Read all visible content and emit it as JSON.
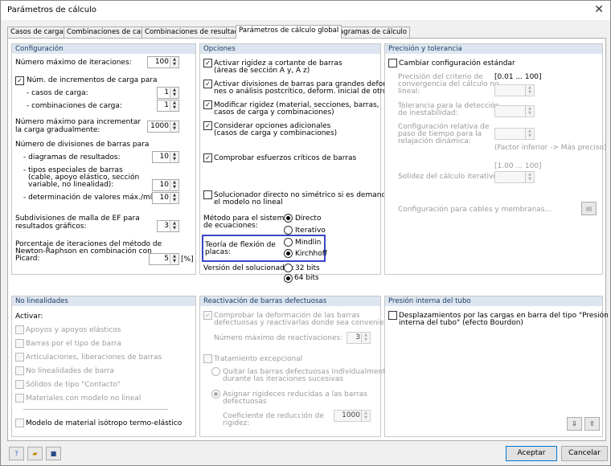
{
  "window": {
    "title": "Parámetros de cálculo",
    "close": "✕"
  },
  "tabs": [
    "Casos de carga",
    "Combinaciones de carga",
    "Combinaciones de resultados",
    "Parámetros de cálculo global",
    "Diagramas de cálculo"
  ],
  "config": {
    "header": "Configuración",
    "max_iter_label": "Número máximo de iteraciones:",
    "max_iter": "100",
    "incr_label": "Núm. de incrementos de carga para",
    "incr_cases_label": "- casos de carga:",
    "incr_cases": "1",
    "incr_combos_label": "- combinaciones de carga:",
    "incr_combos": "1",
    "max_grad_label1": "Número máximo para incrementar",
    "max_grad_label2": "la carga gradualmente:",
    "max_grad": "1000",
    "div_label": "Número de divisiones de barras para",
    "div_diag_label": "- diagramas de resultados:",
    "div_diag": "10",
    "div_special_label1": "- tipos especiales de barras",
    "div_special_label2": "(cable, apoyo elástico, sección",
    "div_special_label3": "variable, no linealidad):",
    "div_special": "10",
    "div_minmax_label": "- determinación de valores máx./mín.:",
    "div_minmax": "10",
    "mesh_label1": "Subdivisiones de malla de EF para",
    "mesh_label2": "resultados gráficos:",
    "mesh": "3",
    "nr_label1": "Porcentaje de iteraciones del método de",
    "nr_label2": "Newton-Raphson en combinación con",
    "nr_label3": "Picard:",
    "nr": "5",
    "nr_unit": "[%]"
  },
  "options": {
    "header": "Opciones",
    "shear1": "Activar rigidez a cortante de barras",
    "shear2": "(áreas de sección A y, A z)",
    "div1": "Activar divisiones de barras para grandes deformacio-",
    "div2": "nes o análisis postcrítico, deform. inicial de otro CC/CO",
    "modify1": "Modificar rigidez (material, secciones, barras,",
    "modify2": "casos de carga y combinaciones)",
    "additional1": "Considerar opciones adicionales",
    "additional2": "(casos de carga y combinaciones)",
    "critical": "Comprobar esfuerzos críticos de barras",
    "direct1": "Solucionador directo no simétrico si es demandado por",
    "direct2": "el modelo no lineal",
    "method_label1": "Método para el sistema",
    "method_label2": "de ecuaciones:",
    "method_direct": "Directo",
    "method_iter": "Iterativo",
    "plate_label1": "Teoría de flexión de",
    "plate_label2": "placas:",
    "mindlin": "Mindlin",
    "kirchhoff": "Kirchhoff",
    "solver_label": "Versión del solucionador:",
    "bits32": "32 bits",
    "bits64": "64 bits"
  },
  "precision": {
    "header": "Precisión y tolerancia",
    "change": "Cambiar configuración estándar",
    "conv1": "Precisión del criterio de",
    "conv2": "convergencia del cálculo no",
    "conv3": "lineal:",
    "conv_range": "[0.01 ... 100]",
    "tol1": "Tolerancia para la detección",
    "tol2": "de inestabilidad:",
    "step1": "Configuración relativa de",
    "step2": "paso de tiempo para la",
    "step3": "relajación dinámica:",
    "step_hint": "(Factor inferior -> Más preciso)",
    "solid_label": "Solidez del cálculo iterativo:",
    "solid_range": "[1.00 ... 100]",
    "cables": "Configuración para cables y membranas..."
  },
  "nonlin": {
    "header": "No linealidades",
    "activate": "Activar:",
    "items": [
      "Apoyos y apoyos elásticos",
      "Barras por el tipo de barra",
      "Articulaciones, liberaciones de barras",
      "No linealidades de barra",
      "Sólidos de tipo \"Contacto\"",
      "Materiales con modelo no lineal"
    ],
    "thermo": "Modelo de material isótropo termo-elástico"
  },
  "reactivation": {
    "header": "Reactivación de barras defectuosas",
    "check1": "Comprobar la deformación de las barras",
    "check2": "defectuosas y reactivarlas donde sea conveniente",
    "max_label": "Número máximo de reactivaciones:",
    "max": "3",
    "exceptional": "Tratamiento excepcional",
    "remove1": "Quitar las barras defectuosas individualmente",
    "remove2": "durante las iteraciones sucesivas",
    "assign1": "Asignar rigideces reducidas a las barras",
    "assign2": "defectuosas",
    "coef1": "Coeficiente de reducción de",
    "coef2": "rigidez:",
    "coef": "1000"
  },
  "pressure": {
    "header": "Presión interna del tubo",
    "disp1": "Desplazamientos por las cargas en barra del tipo \"Presión",
    "disp2": "interna del tubo\" (efecto Bourdon)"
  },
  "footer": {
    "accept": "Aceptar",
    "cancel": "Cancelar"
  }
}
